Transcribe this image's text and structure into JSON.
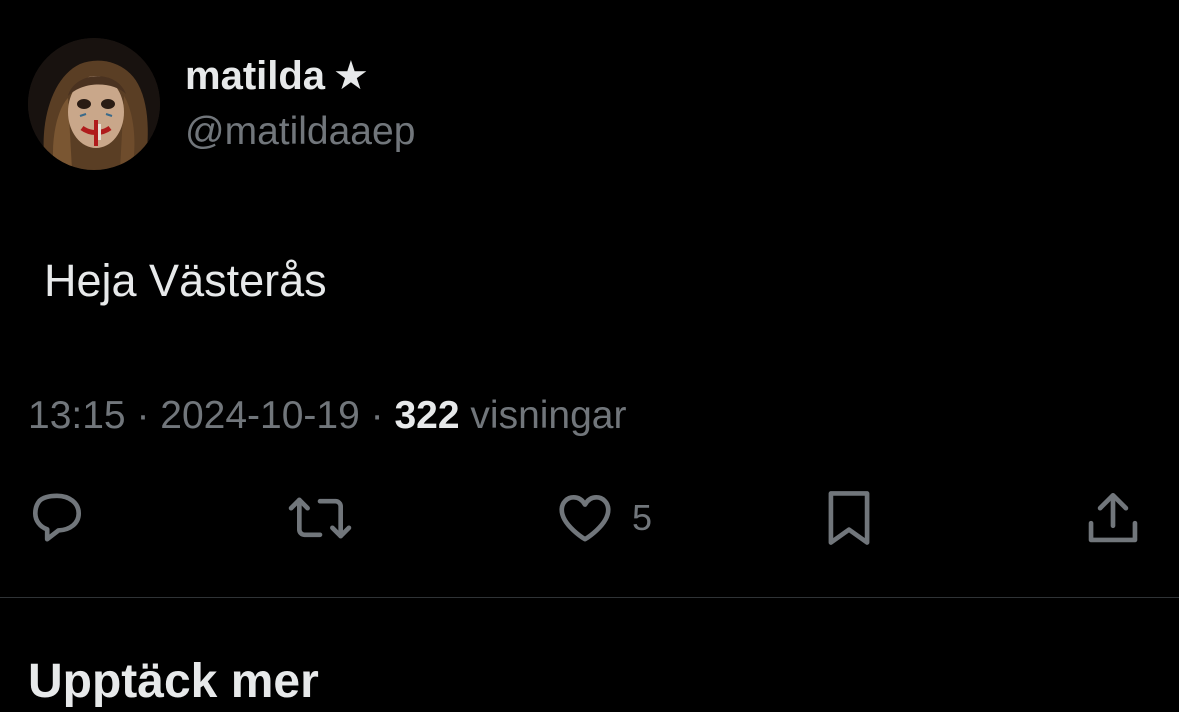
{
  "tweet": {
    "author": {
      "display_name": "matilda",
      "badge_glyph": "★",
      "handle": "@matildaaep",
      "avatar_icon": "avatar-photo"
    },
    "text": "Heja Västerås",
    "time": "13:15",
    "date": "2024-10-19",
    "separator": "·",
    "views_count": "322",
    "views_label": "visningar"
  },
  "actions": {
    "reply": {
      "icon": "reply-icon"
    },
    "retweet": {
      "icon": "retweet-icon"
    },
    "like": {
      "icon": "heart-icon",
      "count": "5"
    },
    "bookmark": {
      "icon": "bookmark-icon"
    },
    "share": {
      "icon": "share-icon"
    }
  },
  "discover": {
    "heading": "Upptäck mer"
  },
  "colors": {
    "background": "#000000",
    "primary_text": "#e7e9ea",
    "secondary_text": "#71767b",
    "divider": "#2f3336"
  }
}
